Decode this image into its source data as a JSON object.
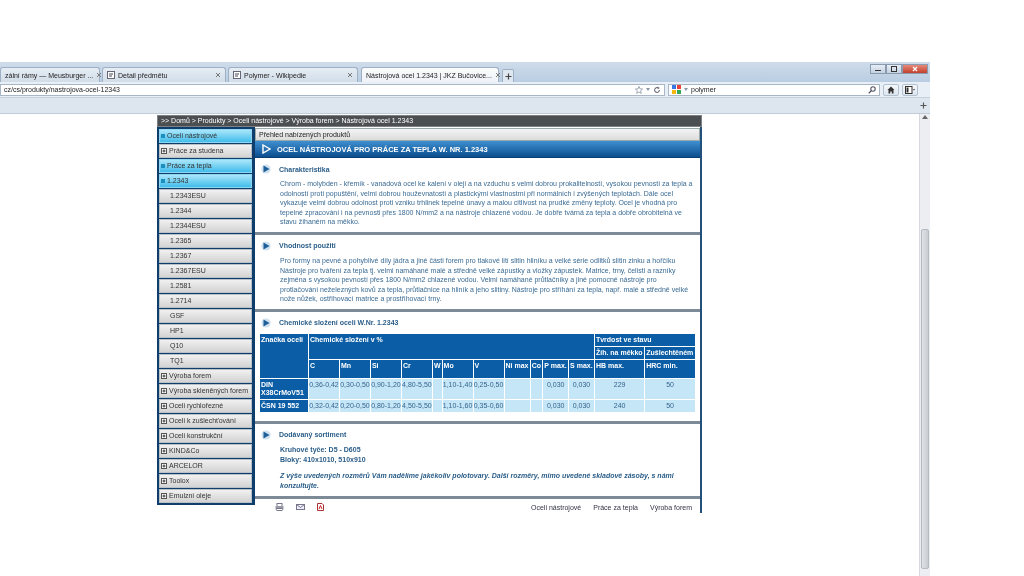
{
  "browser": {
    "tabs": [
      {
        "label": "zální rámy — Meusburger ...",
        "selected": false,
        "favicon": false
      },
      {
        "label": "Detail předmětu",
        "selected": false,
        "favicon": true
      },
      {
        "label": "Polymer - Wikipedie",
        "selected": false,
        "favicon": true
      },
      {
        "label": "Nástrojová ocel 1.2343 | JKZ Bučovice...",
        "selected": true,
        "favicon": false
      }
    ],
    "address": "cz/cs/produkty/nastrojova-ocel-12343",
    "search": "polymer"
  },
  "breadcrumb": ">> Domů > Produkty > Oceli nástrojové > Výroba forem > Nástrojová ocel 1.2343",
  "sidebar": {
    "items": [
      {
        "label": "Oceli nástrojové",
        "expanded": true,
        "children": [
          {
            "label": "Práce za studena",
            "expanded": false
          },
          {
            "label": "Práce za tepla",
            "expanded": true,
            "children": [
              {
                "label": "1.2343",
                "selected": true
              },
              {
                "label": "1.2343ESU",
                "selected": false
              },
              {
                "label": "1.2344",
                "selected": false
              },
              {
                "label": "1.2344ESU",
                "selected": false
              },
              {
                "label": "1.2365",
                "selected": false
              },
              {
                "label": "1.2367",
                "selected": false
              },
              {
                "label": "1.2367ESU",
                "selected": false
              },
              {
                "label": "1.2581",
                "selected": false
              },
              {
                "label": "1.2714",
                "selected": false
              },
              {
                "label": "GSF",
                "selected": false
              },
              {
                "label": "HP1",
                "selected": false
              },
              {
                "label": "Q10",
                "selected": false
              },
              {
                "label": "TQ1",
                "selected": false
              }
            ]
          }
        ]
      },
      {
        "label": "Výroba forem",
        "expanded": false
      },
      {
        "label": "Výroba skleněných forem",
        "expanded": false
      },
      {
        "label": "Oceli rychlořezné",
        "expanded": false
      },
      {
        "label": "Oceli k zušlechťování",
        "expanded": false
      },
      {
        "label": "Oceli konstrukční",
        "expanded": false
      },
      {
        "label": "KIND&Co",
        "expanded": false
      },
      {
        "label": "ARCELOR",
        "expanded": false
      },
      {
        "label": "Toolox",
        "expanded": false
      },
      {
        "label": "Emulzní oleje",
        "expanded": false
      }
    ]
  },
  "overview_title": "Přehled nabízených produktů",
  "product_title": "OCEL NÁSTROJOVÁ PRO PRÁCE ZA TEPLA W. NR. 1.2343",
  "sections": [
    {
      "kind": "text",
      "heading": "Charakteristika",
      "text": "Chrom - molybden - křemík - vanadová ocel ke kalení v oleji a na vzduchu s velmi dobrou prokalitelností, vysokou pevností za tepla a odolností proti popuštění, velmi dobrou houževnatostí a plastickými vlastnostmi při normálních i zvýšených teplotách. Dále ocel vykazuje velmi dobrou odolnost proti vzniku trhlinek tepelné únavy a malou citlivost na prudké změny teploty. Ocel je vhodná pro tepelné zpracování i na pevnosti přes 1800 N/mm2 a na nástroje chlazené vodou. Je dobře tvárná za tepla a dobře obrobitelná ve stavu žíhaném na měkko."
    },
    {
      "kind": "text",
      "heading": "Vhodnost použití",
      "text": "Pro formy na pevné a pohyblivé díly jádra a jiné části forem pro tlakové lití slitin hliníku a velké série odlitků slitin zinku a hořčíku Nástroje pro tváření za tepla tj. velmi namáhané malé a středně velké zápustky a vložky zápustek. Matrice, trny, čelisti a razníky zejména s vysokou pevností přes 1800 N/mm2 chlazené vodou. Velmi namáhané průtlačníky a jiné pomocné nástroje pro protlačování neželezných kovů za tepla, průtlačnice na hliník a jeho slitiny. Nástroje pro stříhání za tepla, např. malé a středně velké nože nůžek, ostřihovací matrice a prostřihovací trny."
    },
    {
      "kind": "table",
      "heading": "Chemické složení oceli W.Nr. 1.2343",
      "table": {
        "grade_header": "Značka oceli",
        "composition_header": "Chemické složení v %",
        "hardness_header": "Tvrdost ve stavu",
        "hardness_states": [
          "Žíh. na měkko",
          "Zušlechtěném"
        ],
        "columns": [
          "C",
          "Mn",
          "Si",
          "Cr",
          "W",
          "Mo",
          "V",
          "Ni max",
          "Co",
          "P max.",
          "S max.",
          "HB max.",
          "HRC min."
        ],
        "rows": [
          {
            "grade": "DIN X38CrMoV51",
            "cells": [
              "0,36-0,42",
              "0,30-0,50",
              "0,90-1,20",
              "4,80-5,50",
              null,
              "1,10-1,40",
              "0,25-0,50",
              null,
              null,
              "0,030",
              "0,030",
              "229",
              "50"
            ]
          },
          {
            "grade": "ČSN 19 552",
            "cells": [
              "0,32-0,42",
              "0,20-0,50",
              "0,80-1,20",
              "4,50-5,50",
              null,
              "1,10-1,60",
              "0,35-0,60",
              null,
              null,
              "0,030",
              "0,030",
              "240",
              "50"
            ]
          }
        ]
      }
    },
    {
      "kind": "list",
      "heading": "Dodávaný sortiment",
      "lines": [
        "Kruhové tyče: D5 - D605",
        "Bloky: 410x1010, 510x910"
      ],
      "note": "Z výše uvedených rozměrů Vám nadělíme jakékoliv polotovary. Další rozměry, mimo uvedené skladové zásoby, s námi konzultujte."
    }
  ],
  "footer_links": [
    "Oceli nástrojové",
    "Práce za tepla",
    "Výroba forem"
  ]
}
